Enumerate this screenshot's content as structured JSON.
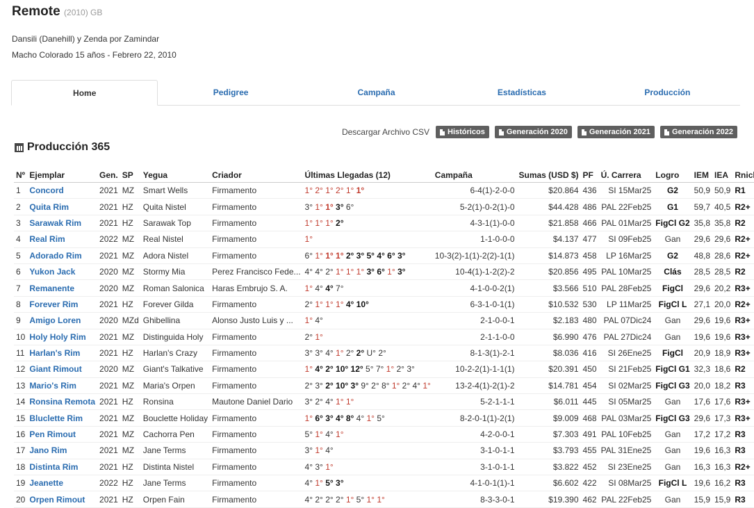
{
  "header": {
    "name": "Remote",
    "sub": "(2010) GB",
    "pedigree": "Dansili (Danehill) y Zenda por Zamindar",
    "details": "Macho Colorado 15 años - Febrero 22, 2010"
  },
  "tabs": [
    "Home",
    "Pedigree",
    "Campaña",
    "Estadísticas",
    "Producción"
  ],
  "csv": {
    "label": "Descargar Archivo CSV",
    "buttons": [
      "Históricos",
      "Generación 2020",
      "Generación 2021",
      "Generación 2022"
    ]
  },
  "section_title": "Producción 365",
  "columns": [
    "Nº",
    "Ejemplar",
    "Gen.",
    "SP",
    "Yegua",
    "Criador",
    "Últimas Llegadas (12)",
    "Campaña",
    "Sumas (USD $)",
    "PF",
    "Ú. Carrera",
    "Logro",
    "IEM",
    "IEA",
    "Rnick"
  ],
  "rows": [
    {
      "n": "1",
      "name": "Concord",
      "gen": "2021",
      "sp": "MZ",
      "dam": "Smart Wells",
      "breeder": "Firmamento",
      "arrivals": [
        [
          "1°",
          "r"
        ],
        [
          "2°",
          "r"
        ],
        [
          "1°",
          "r"
        ],
        [
          "2°",
          "r"
        ],
        [
          "1°",
          "r"
        ],
        [
          "1°",
          "rb"
        ]
      ],
      "camp": "6-4(1)-2-0-0",
      "sum": "$20.864",
      "pf": "436",
      "last": "SI 15Mar25",
      "logro": "G2",
      "logro_bold": true,
      "iem": "50,9",
      "iea": "50,9",
      "rnick": "R1"
    },
    {
      "n": "2",
      "name": "Quita Rim",
      "gen": "2021",
      "sp": "HZ",
      "dam": "Quita Nistel",
      "breeder": "Firmamento",
      "arrivals": [
        [
          "3°",
          "n"
        ],
        [
          "1°",
          "r"
        ],
        [
          "1°",
          "rb"
        ],
        [
          "3°",
          "b"
        ],
        [
          "6°",
          "n"
        ]
      ],
      "camp": "5-2(1)-0-2(1)-0",
      "sum": "$44.428",
      "pf": "486",
      "last": "PAL 22Feb25",
      "logro": "G1",
      "logro_bold": true,
      "iem": "59,7",
      "iea": "40,5",
      "rnick": "R2+"
    },
    {
      "n": "3",
      "name": "Sarawak Rim",
      "gen": "2021",
      "sp": "HZ",
      "dam": "Sarawak Top",
      "breeder": "Firmamento",
      "arrivals": [
        [
          "1°",
          "r"
        ],
        [
          "1°",
          "r"
        ],
        [
          "1°",
          "r"
        ],
        [
          "2°",
          "b"
        ]
      ],
      "camp": "4-3-1(1)-0-0",
      "sum": "$21.858",
      "pf": "466",
      "last": "PAL 01Mar25",
      "logro": "FigCl G2",
      "logro_bold": true,
      "iem": "35,8",
      "iea": "35,8",
      "rnick": "R2"
    },
    {
      "n": "4",
      "name": "Real Rim",
      "gen": "2022",
      "sp": "MZ",
      "dam": "Real Nistel",
      "breeder": "Firmamento",
      "arrivals": [
        [
          "1°",
          "r"
        ]
      ],
      "camp": "1-1-0-0-0",
      "sum": "$4.137",
      "pf": "477",
      "last": "SI 09Feb25",
      "logro": "Gan",
      "logro_bold": false,
      "iem": "29,6",
      "iea": "29,6",
      "rnick": "R2+"
    },
    {
      "n": "5",
      "name": "Adorado Rim",
      "gen": "2021",
      "sp": "MZ",
      "dam": "Adora Nistel",
      "breeder": "Firmamento",
      "arrivals": [
        [
          "6°",
          "n"
        ],
        [
          "1°",
          "r"
        ],
        [
          "1°",
          "rb"
        ],
        [
          "1°",
          "rb"
        ],
        [
          "2°",
          "b"
        ],
        [
          "3°",
          "b"
        ],
        [
          "5°",
          "b"
        ],
        [
          "4°",
          "b"
        ],
        [
          "6°",
          "b"
        ],
        [
          "3°",
          "b"
        ]
      ],
      "camp": "10-3(2)-1(1)-2(2)-1(1)",
      "sum": "$14.873",
      "pf": "458",
      "last": "LP 16Mar25",
      "logro": "G2",
      "logro_bold": true,
      "iem": "48,8",
      "iea": "28,6",
      "rnick": "R2+"
    },
    {
      "n": "6",
      "name": "Yukon Jack",
      "gen": "2020",
      "sp": "MZ",
      "dam": "Stormy Mia",
      "breeder": "Perez Francisco Fede...",
      "arrivals": [
        [
          "4°",
          "n"
        ],
        [
          "4°",
          "n"
        ],
        [
          "2°",
          "n"
        ],
        [
          "1°",
          "r"
        ],
        [
          "1°",
          "r"
        ],
        [
          "1°",
          "r"
        ],
        [
          "3°",
          "b"
        ],
        [
          "6°",
          "b"
        ],
        [
          "1°",
          "r"
        ],
        [
          "3°",
          "b"
        ]
      ],
      "camp": "10-4(1)-1-2(2)-2",
      "sum": "$20.856",
      "pf": "495",
      "last": "PAL 10Mar25",
      "logro": "Clás",
      "logro_bold": true,
      "iem": "28,5",
      "iea": "28,5",
      "rnick": "R2"
    },
    {
      "n": "7",
      "name": "Remanente",
      "gen": "2020",
      "sp": "MZ",
      "dam": "Roman Salonica",
      "breeder": "Haras Embrujo S. A.",
      "arrivals": [
        [
          "1°",
          "r"
        ],
        [
          "4°",
          "n"
        ],
        [
          "4°",
          "b"
        ],
        [
          "7°",
          "n"
        ]
      ],
      "camp": "4-1-0-0-2(1)",
      "sum": "$3.566",
      "pf": "510",
      "last": "PAL 28Feb25",
      "logro": "FigCl",
      "logro_bold": true,
      "iem": "29,6",
      "iea": "20,2",
      "rnick": "R3+"
    },
    {
      "n": "8",
      "name": "Forever Rim",
      "gen": "2021",
      "sp": "HZ",
      "dam": "Forever Gilda",
      "breeder": "Firmamento",
      "arrivals": [
        [
          "2°",
          "n"
        ],
        [
          "1°",
          "r"
        ],
        [
          "1°",
          "r"
        ],
        [
          "1°",
          "r"
        ],
        [
          "4°",
          "b"
        ],
        [
          "10°",
          "b"
        ]
      ],
      "camp": "6-3-1-0-1(1)",
      "sum": "$10.532",
      "pf": "530",
      "last": "LP 11Mar25",
      "logro": "FigCl L",
      "logro_bold": true,
      "iem": "27,1",
      "iea": "20,0",
      "rnick": "R2+"
    },
    {
      "n": "9",
      "name": "Amigo Loren",
      "gen": "2020",
      "sp": "MZd",
      "dam": "Ghibellina",
      "breeder": "Alonso Justo Luis y ...",
      "arrivals": [
        [
          "1°",
          "r"
        ],
        [
          "4°",
          "n"
        ]
      ],
      "camp": "2-1-0-0-1",
      "sum": "$2.183",
      "pf": "480",
      "last": "PAL 07Dic24",
      "logro": "Gan",
      "logro_bold": false,
      "iem": "29,6",
      "iea": "19,6",
      "rnick": "R3+"
    },
    {
      "n": "10",
      "name": "Holy Holy Rim",
      "gen": "2021",
      "sp": "MZ",
      "dam": "Distinguida Holy",
      "breeder": "Firmamento",
      "arrivals": [
        [
          "2°",
          "n"
        ],
        [
          "1°",
          "r"
        ]
      ],
      "camp": "2-1-1-0-0",
      "sum": "$6.990",
      "pf": "476",
      "last": "PAL 27Dic24",
      "logro": "Gan",
      "logro_bold": false,
      "iem": "19,6",
      "iea": "19,6",
      "rnick": "R3+"
    },
    {
      "n": "11",
      "name": "Harlan's Rim",
      "gen": "2021",
      "sp": "HZ",
      "dam": "Harlan's Crazy",
      "breeder": "Firmamento",
      "arrivals": [
        [
          "3°",
          "n"
        ],
        [
          "3°",
          "n"
        ],
        [
          "4°",
          "n"
        ],
        [
          "1°",
          "r"
        ],
        [
          "2°",
          "n"
        ],
        [
          "2°",
          "b"
        ],
        [
          "U°",
          "n"
        ],
        [
          "2°",
          "n"
        ]
      ],
      "camp": "8-1-3(1)-2-1",
      "sum": "$8.036",
      "pf": "416",
      "last": "SI 26Ene25",
      "logro": "FigCl",
      "logro_bold": true,
      "iem": "20,9",
      "iea": "18,9",
      "rnick": "R3+"
    },
    {
      "n": "12",
      "name": "Giant Rimout",
      "gen": "2020",
      "sp": "MZ",
      "dam": "Giant's Talkative",
      "breeder": "Firmamento",
      "arrivals": [
        [
          "1°",
          "r"
        ],
        [
          "4°",
          "b"
        ],
        [
          "2°",
          "b"
        ],
        [
          "10°",
          "b"
        ],
        [
          "12°",
          "b"
        ],
        [
          "5°",
          "n"
        ],
        [
          "7°",
          "n"
        ],
        [
          "1°",
          "r"
        ],
        [
          "2°",
          "n"
        ],
        [
          "3°",
          "n"
        ]
      ],
      "camp": "10-2-2(1)-1-1(1)",
      "sum": "$20.391",
      "pf": "450",
      "last": "SI 21Feb25",
      "logro": "FigCl G1",
      "logro_bold": true,
      "iem": "32,3",
      "iea": "18,6",
      "rnick": "R2"
    },
    {
      "n": "13",
      "name": "Mario's Rim",
      "gen": "2021",
      "sp": "MZ",
      "dam": "Maria's Orpen",
      "breeder": "Firmamento",
      "arrivals": [
        [
          "2°",
          "n"
        ],
        [
          "3°",
          "n"
        ],
        [
          "2°",
          "b"
        ],
        [
          "10°",
          "b"
        ],
        [
          "3°",
          "b"
        ],
        [
          "9°",
          "n"
        ],
        [
          "2°",
          "n"
        ],
        [
          "8°",
          "n"
        ],
        [
          "1°",
          "r"
        ],
        [
          "2°",
          "n"
        ],
        [
          "4°",
          "n"
        ],
        [
          "1°",
          "r"
        ]
      ],
      "camp": "13-2-4(1)-2(1)-2",
      "sum": "$14.781",
      "pf": "454",
      "last": "SI 02Mar25",
      "logro": "FigCl G3",
      "logro_bold": true,
      "iem": "20,0",
      "iea": "18,2",
      "rnick": "R3"
    },
    {
      "n": "14",
      "name": "Ronsina Remota",
      "gen": "2021",
      "sp": "HZ",
      "dam": "Ronsina",
      "breeder": "Mautone Daniel Dario",
      "arrivals": [
        [
          "3°",
          "n"
        ],
        [
          "2°",
          "n"
        ],
        [
          "4°",
          "n"
        ],
        [
          "1°",
          "r"
        ],
        [
          "1°",
          "r"
        ]
      ],
      "camp": "5-2-1-1-1",
      "sum": "$6.011",
      "pf": "445",
      "last": "SI 05Mar25",
      "logro": "Gan",
      "logro_bold": false,
      "iem": "17,6",
      "iea": "17,6",
      "rnick": "R3+"
    },
    {
      "n": "15",
      "name": "Bluclette Rim",
      "gen": "2021",
      "sp": "MZ",
      "dam": "Bouclette Holiday",
      "breeder": "Firmamento",
      "arrivals": [
        [
          "1°",
          "r"
        ],
        [
          "6°",
          "b"
        ],
        [
          "3°",
          "b"
        ],
        [
          "4°",
          "b"
        ],
        [
          "8°",
          "b"
        ],
        [
          "4°",
          "n"
        ],
        [
          "1°",
          "r"
        ],
        [
          "5°",
          "n"
        ]
      ],
      "camp": "8-2-0-1(1)-2(1)",
      "sum": "$9.009",
      "pf": "468",
      "last": "PAL 03Mar25",
      "logro": "FigCl G3",
      "logro_bold": true,
      "iem": "29,6",
      "iea": "17,3",
      "rnick": "R3+"
    },
    {
      "n": "16",
      "name": "Pen Rimout",
      "gen": "2021",
      "sp": "MZ",
      "dam": "Cachorra Pen",
      "breeder": "Firmamento",
      "arrivals": [
        [
          "5°",
          "n"
        ],
        [
          "1°",
          "r"
        ],
        [
          "4°",
          "n"
        ],
        [
          "1°",
          "r"
        ]
      ],
      "camp": "4-2-0-0-1",
      "sum": "$7.303",
      "pf": "491",
      "last": "PAL 10Feb25",
      "logro": "Gan",
      "logro_bold": false,
      "iem": "17,2",
      "iea": "17,2",
      "rnick": "R3"
    },
    {
      "n": "17",
      "name": "Jano Rim",
      "gen": "2021",
      "sp": "MZ",
      "dam": "Jane Terms",
      "breeder": "Firmamento",
      "arrivals": [
        [
          "3°",
          "n"
        ],
        [
          "1°",
          "r"
        ],
        [
          "4°",
          "n"
        ]
      ],
      "camp": "3-1-0-1-1",
      "sum": "$3.793",
      "pf": "455",
      "last": "PAL 31Ene25",
      "logro": "Gan",
      "logro_bold": false,
      "iem": "19,6",
      "iea": "16,3",
      "rnick": "R3"
    },
    {
      "n": "18",
      "name": "Distinta Rim",
      "gen": "2021",
      "sp": "HZ",
      "dam": "Distinta Nistel",
      "breeder": "Firmamento",
      "arrivals": [
        [
          "4°",
          "n"
        ],
        [
          "3°",
          "n"
        ],
        [
          "1°",
          "r"
        ]
      ],
      "camp": "3-1-0-1-1",
      "sum": "$3.822",
      "pf": "452",
      "last": "SI 23Ene25",
      "logro": "Gan",
      "logro_bold": false,
      "iem": "16,3",
      "iea": "16,3",
      "rnick": "R2+"
    },
    {
      "n": "19",
      "name": "Jeanette",
      "gen": "2022",
      "sp": "HZ",
      "dam": "Jane Terms",
      "breeder": "Firmamento",
      "arrivals": [
        [
          "4°",
          "n"
        ],
        [
          "1°",
          "r"
        ],
        [
          "5°",
          "b"
        ],
        [
          "3°",
          "b"
        ]
      ],
      "camp": "4-1-0-1(1)-1",
      "sum": "$6.602",
      "pf": "422",
      "last": "SI 08Mar25",
      "logro": "FigCl L",
      "logro_bold": true,
      "iem": "19,6",
      "iea": "16,2",
      "rnick": "R3"
    },
    {
      "n": "20",
      "name": "Orpen Rimout",
      "gen": "2021",
      "sp": "HZ",
      "dam": "Orpen Fain",
      "breeder": "Firmamento",
      "arrivals": [
        [
          "4°",
          "n"
        ],
        [
          "2°",
          "n"
        ],
        [
          "2°",
          "n"
        ],
        [
          "2°",
          "n"
        ],
        [
          "1°",
          "r"
        ],
        [
          "5°",
          "n"
        ],
        [
          "1°",
          "r"
        ],
        [
          "1°",
          "r"
        ]
      ],
      "camp": "8-3-3-0-1",
      "sum": "$19.390",
      "pf": "462",
      "last": "PAL 22Feb25",
      "logro": "Gan",
      "logro_bold": false,
      "iem": "15,9",
      "iea": "15,9",
      "rnick": "R3"
    }
  ]
}
